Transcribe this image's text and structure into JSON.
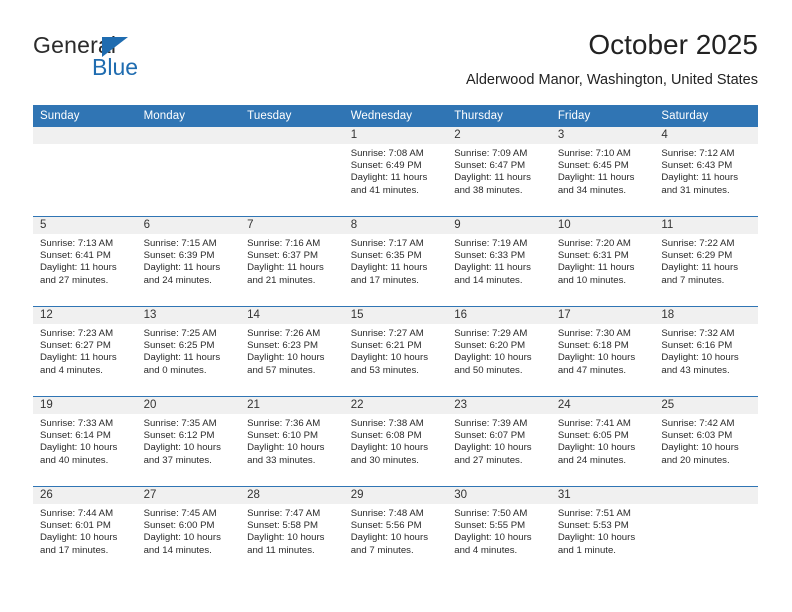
{
  "brand": {
    "name_part1": "General",
    "name_part2": "Blue",
    "accent_color": "#1f6cb0"
  },
  "header": {
    "title": "October 2025",
    "location": "Alderwood Manor, Washington, United States"
  },
  "theme": {
    "header_blue": "#3075b4",
    "day_band_gray": "#f0f0f0",
    "text": "#2a2a2a"
  },
  "weekday_headers": [
    "Sunday",
    "Monday",
    "Tuesday",
    "Wednesday",
    "Thursday",
    "Friday",
    "Saturday"
  ],
  "weeks": [
    [
      {
        "day": "",
        "sunrise": "",
        "sunset": "",
        "daylight": "",
        "empty": true
      },
      {
        "day": "",
        "sunrise": "",
        "sunset": "",
        "daylight": "",
        "empty": true
      },
      {
        "day": "",
        "sunrise": "",
        "sunset": "",
        "daylight": "",
        "empty": true
      },
      {
        "day": "1",
        "sunrise": "Sunrise: 7:08 AM",
        "sunset": "Sunset: 6:49 PM",
        "daylight": "Daylight: 11 hours and 41 minutes."
      },
      {
        "day": "2",
        "sunrise": "Sunrise: 7:09 AM",
        "sunset": "Sunset: 6:47 PM",
        "daylight": "Daylight: 11 hours and 38 minutes."
      },
      {
        "day": "3",
        "sunrise": "Sunrise: 7:10 AM",
        "sunset": "Sunset: 6:45 PM",
        "daylight": "Daylight: 11 hours and 34 minutes."
      },
      {
        "day": "4",
        "sunrise": "Sunrise: 7:12 AM",
        "sunset": "Sunset: 6:43 PM",
        "daylight": "Daylight: 11 hours and 31 minutes."
      }
    ],
    [
      {
        "day": "5",
        "sunrise": "Sunrise: 7:13 AM",
        "sunset": "Sunset: 6:41 PM",
        "daylight": "Daylight: 11 hours and 27 minutes."
      },
      {
        "day": "6",
        "sunrise": "Sunrise: 7:15 AM",
        "sunset": "Sunset: 6:39 PM",
        "daylight": "Daylight: 11 hours and 24 minutes."
      },
      {
        "day": "7",
        "sunrise": "Sunrise: 7:16 AM",
        "sunset": "Sunset: 6:37 PM",
        "daylight": "Daylight: 11 hours and 21 minutes."
      },
      {
        "day": "8",
        "sunrise": "Sunrise: 7:17 AM",
        "sunset": "Sunset: 6:35 PM",
        "daylight": "Daylight: 11 hours and 17 minutes."
      },
      {
        "day": "9",
        "sunrise": "Sunrise: 7:19 AM",
        "sunset": "Sunset: 6:33 PM",
        "daylight": "Daylight: 11 hours and 14 minutes."
      },
      {
        "day": "10",
        "sunrise": "Sunrise: 7:20 AM",
        "sunset": "Sunset: 6:31 PM",
        "daylight": "Daylight: 11 hours and 10 minutes."
      },
      {
        "day": "11",
        "sunrise": "Sunrise: 7:22 AM",
        "sunset": "Sunset: 6:29 PM",
        "daylight": "Daylight: 11 hours and 7 minutes."
      }
    ],
    [
      {
        "day": "12",
        "sunrise": "Sunrise: 7:23 AM",
        "sunset": "Sunset: 6:27 PM",
        "daylight": "Daylight: 11 hours and 4 minutes."
      },
      {
        "day": "13",
        "sunrise": "Sunrise: 7:25 AM",
        "sunset": "Sunset: 6:25 PM",
        "daylight": "Daylight: 11 hours and 0 minutes."
      },
      {
        "day": "14",
        "sunrise": "Sunrise: 7:26 AM",
        "sunset": "Sunset: 6:23 PM",
        "daylight": "Daylight: 10 hours and 57 minutes."
      },
      {
        "day": "15",
        "sunrise": "Sunrise: 7:27 AM",
        "sunset": "Sunset: 6:21 PM",
        "daylight": "Daylight: 10 hours and 53 minutes."
      },
      {
        "day": "16",
        "sunrise": "Sunrise: 7:29 AM",
        "sunset": "Sunset: 6:20 PM",
        "daylight": "Daylight: 10 hours and 50 minutes."
      },
      {
        "day": "17",
        "sunrise": "Sunrise: 7:30 AM",
        "sunset": "Sunset: 6:18 PM",
        "daylight": "Daylight: 10 hours and 47 minutes."
      },
      {
        "day": "18",
        "sunrise": "Sunrise: 7:32 AM",
        "sunset": "Sunset: 6:16 PM",
        "daylight": "Daylight: 10 hours and 43 minutes."
      }
    ],
    [
      {
        "day": "19",
        "sunrise": "Sunrise: 7:33 AM",
        "sunset": "Sunset: 6:14 PM",
        "daylight": "Daylight: 10 hours and 40 minutes."
      },
      {
        "day": "20",
        "sunrise": "Sunrise: 7:35 AM",
        "sunset": "Sunset: 6:12 PM",
        "daylight": "Daylight: 10 hours and 37 minutes."
      },
      {
        "day": "21",
        "sunrise": "Sunrise: 7:36 AM",
        "sunset": "Sunset: 6:10 PM",
        "daylight": "Daylight: 10 hours and 33 minutes."
      },
      {
        "day": "22",
        "sunrise": "Sunrise: 7:38 AM",
        "sunset": "Sunset: 6:08 PM",
        "daylight": "Daylight: 10 hours and 30 minutes."
      },
      {
        "day": "23",
        "sunrise": "Sunrise: 7:39 AM",
        "sunset": "Sunset: 6:07 PM",
        "daylight": "Daylight: 10 hours and 27 minutes."
      },
      {
        "day": "24",
        "sunrise": "Sunrise: 7:41 AM",
        "sunset": "Sunset: 6:05 PM",
        "daylight": "Daylight: 10 hours and 24 minutes."
      },
      {
        "day": "25",
        "sunrise": "Sunrise: 7:42 AM",
        "sunset": "Sunset: 6:03 PM",
        "daylight": "Daylight: 10 hours and 20 minutes."
      }
    ],
    [
      {
        "day": "26",
        "sunrise": "Sunrise: 7:44 AM",
        "sunset": "Sunset: 6:01 PM",
        "daylight": "Daylight: 10 hours and 17 minutes."
      },
      {
        "day": "27",
        "sunrise": "Sunrise: 7:45 AM",
        "sunset": "Sunset: 6:00 PM",
        "daylight": "Daylight: 10 hours and 14 minutes."
      },
      {
        "day": "28",
        "sunrise": "Sunrise: 7:47 AM",
        "sunset": "Sunset: 5:58 PM",
        "daylight": "Daylight: 10 hours and 11 minutes."
      },
      {
        "day": "29",
        "sunrise": "Sunrise: 7:48 AM",
        "sunset": "Sunset: 5:56 PM",
        "daylight": "Daylight: 10 hours and 7 minutes."
      },
      {
        "day": "30",
        "sunrise": "Sunrise: 7:50 AM",
        "sunset": "Sunset: 5:55 PM",
        "daylight": "Daylight: 10 hours and 4 minutes."
      },
      {
        "day": "31",
        "sunrise": "Sunrise: 7:51 AM",
        "sunset": "Sunset: 5:53 PM",
        "daylight": "Daylight: 10 hours and 1 minute."
      },
      {
        "day": "",
        "sunrise": "",
        "sunset": "",
        "daylight": "",
        "empty": true
      }
    ]
  ]
}
